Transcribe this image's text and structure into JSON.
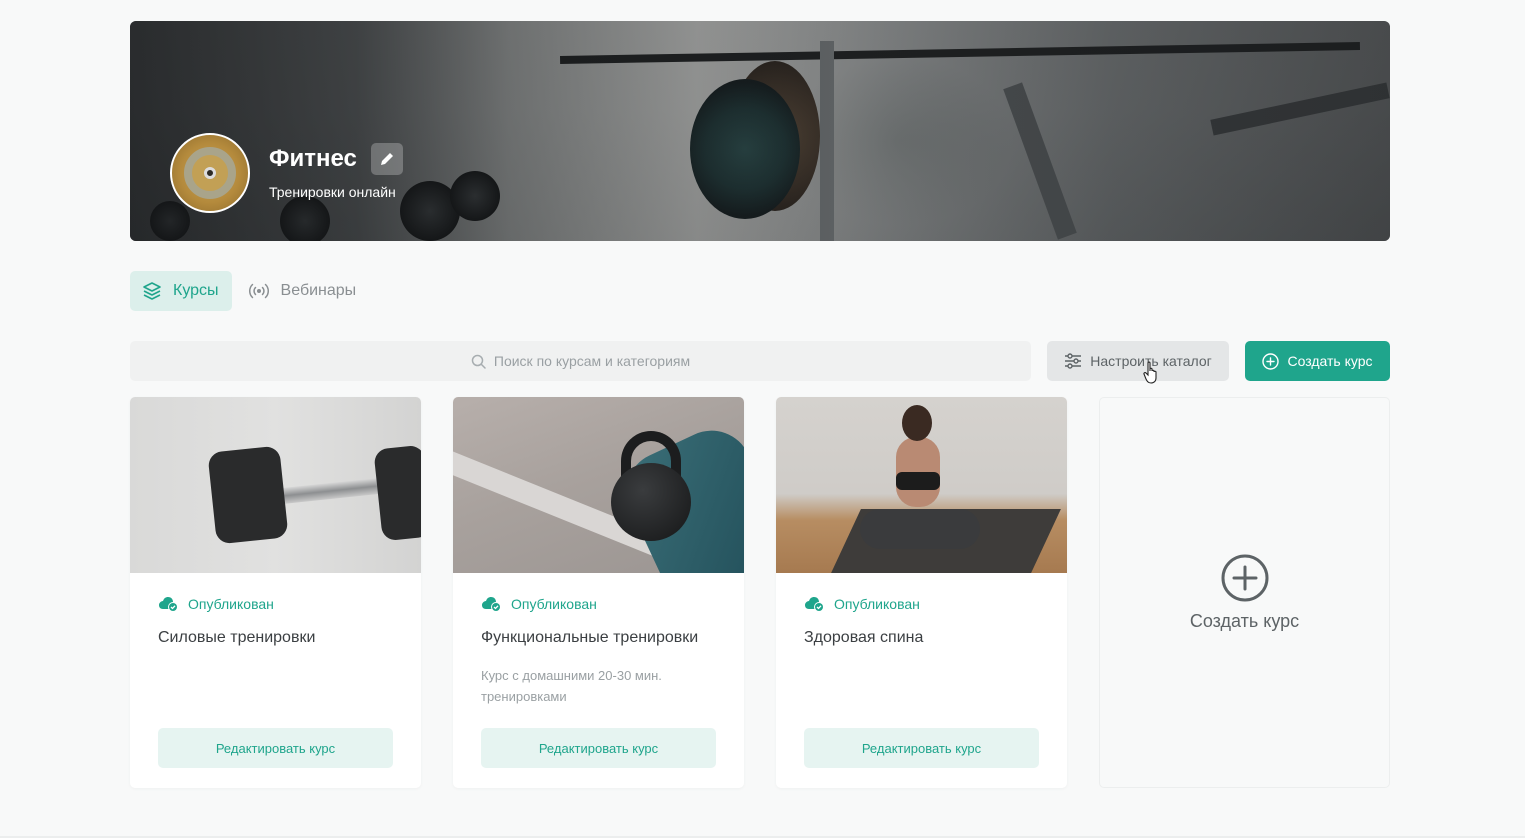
{
  "header": {
    "title": "Фитнес",
    "subtitle": "Тренировки онлайн"
  },
  "tabs": [
    {
      "label": "Курсы",
      "icon": "layers-icon",
      "active": true
    },
    {
      "label": "Вебинары",
      "icon": "broadcast-icon",
      "active": false
    }
  ],
  "toolbar": {
    "search_placeholder": "Поиск по курсам и категориям",
    "catalog_label": "Настроить каталог",
    "create_label": "Создать курс"
  },
  "courses": [
    {
      "status": "Опубликован",
      "title": "Силовые тренировки",
      "description": "",
      "edit_label": "Редактировать курс"
    },
    {
      "status": "Опубликован",
      "title": "Функциональные тренировки",
      "description": "Курс с домашними 20-30 мин. тренировками",
      "edit_label": "Редактировать курс"
    },
    {
      "status": "Опубликован",
      "title": "Здоровая спина",
      "description": "",
      "edit_label": "Редактировать курс"
    }
  ],
  "create_card": {
    "label": "Создать курс"
  },
  "colors": {
    "accent": "#1fa58c",
    "accent_light": "#e6f4f1",
    "tab_active_bg": "#dcefeb"
  }
}
